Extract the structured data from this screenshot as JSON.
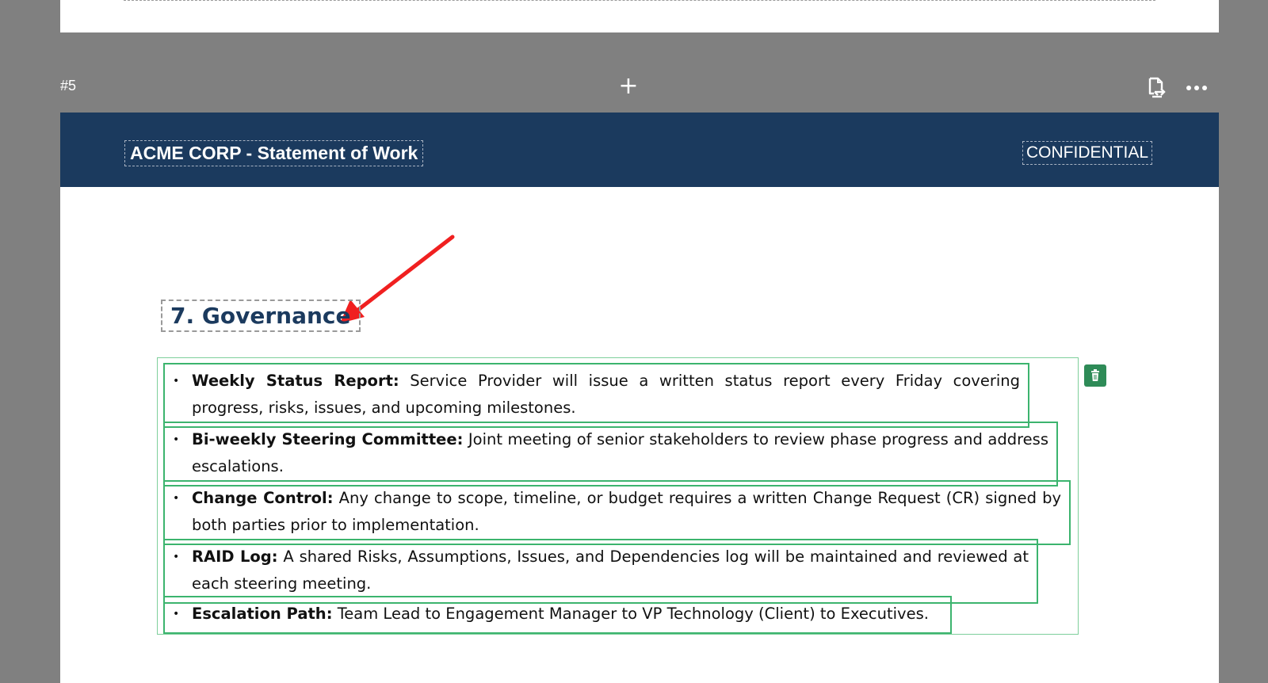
{
  "toolbar": {
    "page_number": "#5",
    "add_label": "+"
  },
  "page": {
    "header_title": "ACME CORP - Statement of Work",
    "header_confidential": "CONFIDENTIAL",
    "section_heading": "7. Governance",
    "items": [
      {
        "term": "Weekly Status Report:",
        "text": " Service Provider will issue a written status report every Friday covering progress, risks, issues, and upcoming milestones."
      },
      {
        "term": "Bi-weekly Steering Committee:",
        "text": " Joint meeting of senior stakeholders to review phase progress and address escalations."
      },
      {
        "term": "Change Control:",
        "text": " Any change to scope, timeline, or budget requires a written Change Request (CR) signed by both parties prior to implementation."
      },
      {
        "term": "RAID Log:",
        "text": " A shared Risks, Assumptions, Issues, and Dependencies log will be maintained and reviewed at each steering meeting."
      },
      {
        "term": "Escalation Path:",
        "text": " Team Lead to Engagement Manager to VP Technology (Client) to Executives."
      }
    ]
  },
  "colors": {
    "canvas_bg": "#808080",
    "header_band": "#1b3a5e",
    "heading_text": "#1b3a5e",
    "selection_green": "#3cb46e",
    "delete_button": "#2e8b57",
    "annotation_arrow": "#f02020"
  },
  "icons": {
    "add": "plus-icon",
    "share": "share-export-icon",
    "more": "more-horizontal-icon",
    "delete": "trash-icon",
    "annotation": "red-arrow-annotation"
  }
}
